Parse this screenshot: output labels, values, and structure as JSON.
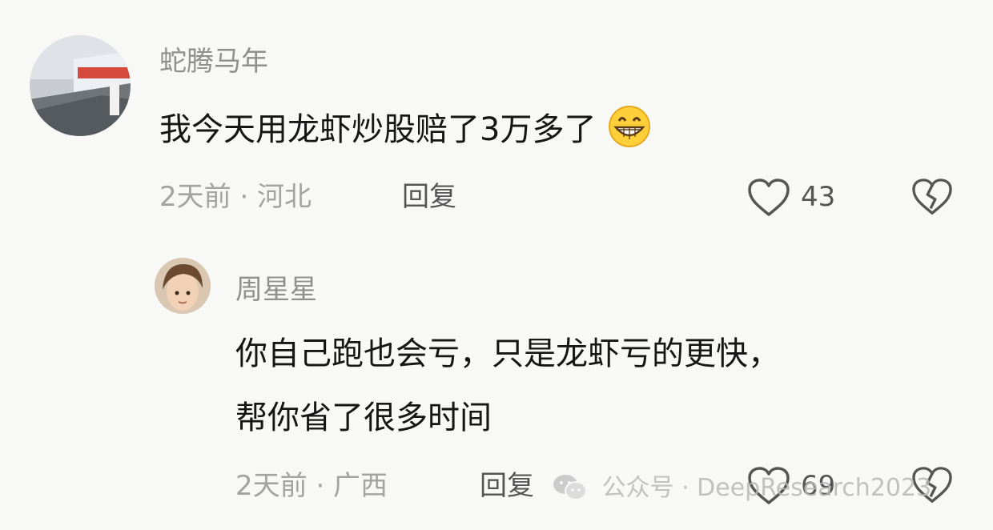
{
  "comment": {
    "username": "蛇腾马年",
    "text": "我今天用龙虾炒股赔了3万多了",
    "emoji": "grin-emoji",
    "time_location": "2天前 · 河北",
    "reply_label": "回复",
    "like_count": "43"
  },
  "reply": {
    "username": "周星星",
    "text_line1": "你自己跑也会亏，只是龙虾亏的更快，",
    "text_line2": "帮你省了很多时间",
    "time_location": "2天前 · 广西",
    "reply_label": "回复",
    "like_count": "69"
  },
  "watermark": {
    "text": "公众号 · DeepResearch2023"
  },
  "icons": {
    "like": "heart-icon",
    "dislike": "broken-heart-icon",
    "wechat": "wechat-icon"
  }
}
